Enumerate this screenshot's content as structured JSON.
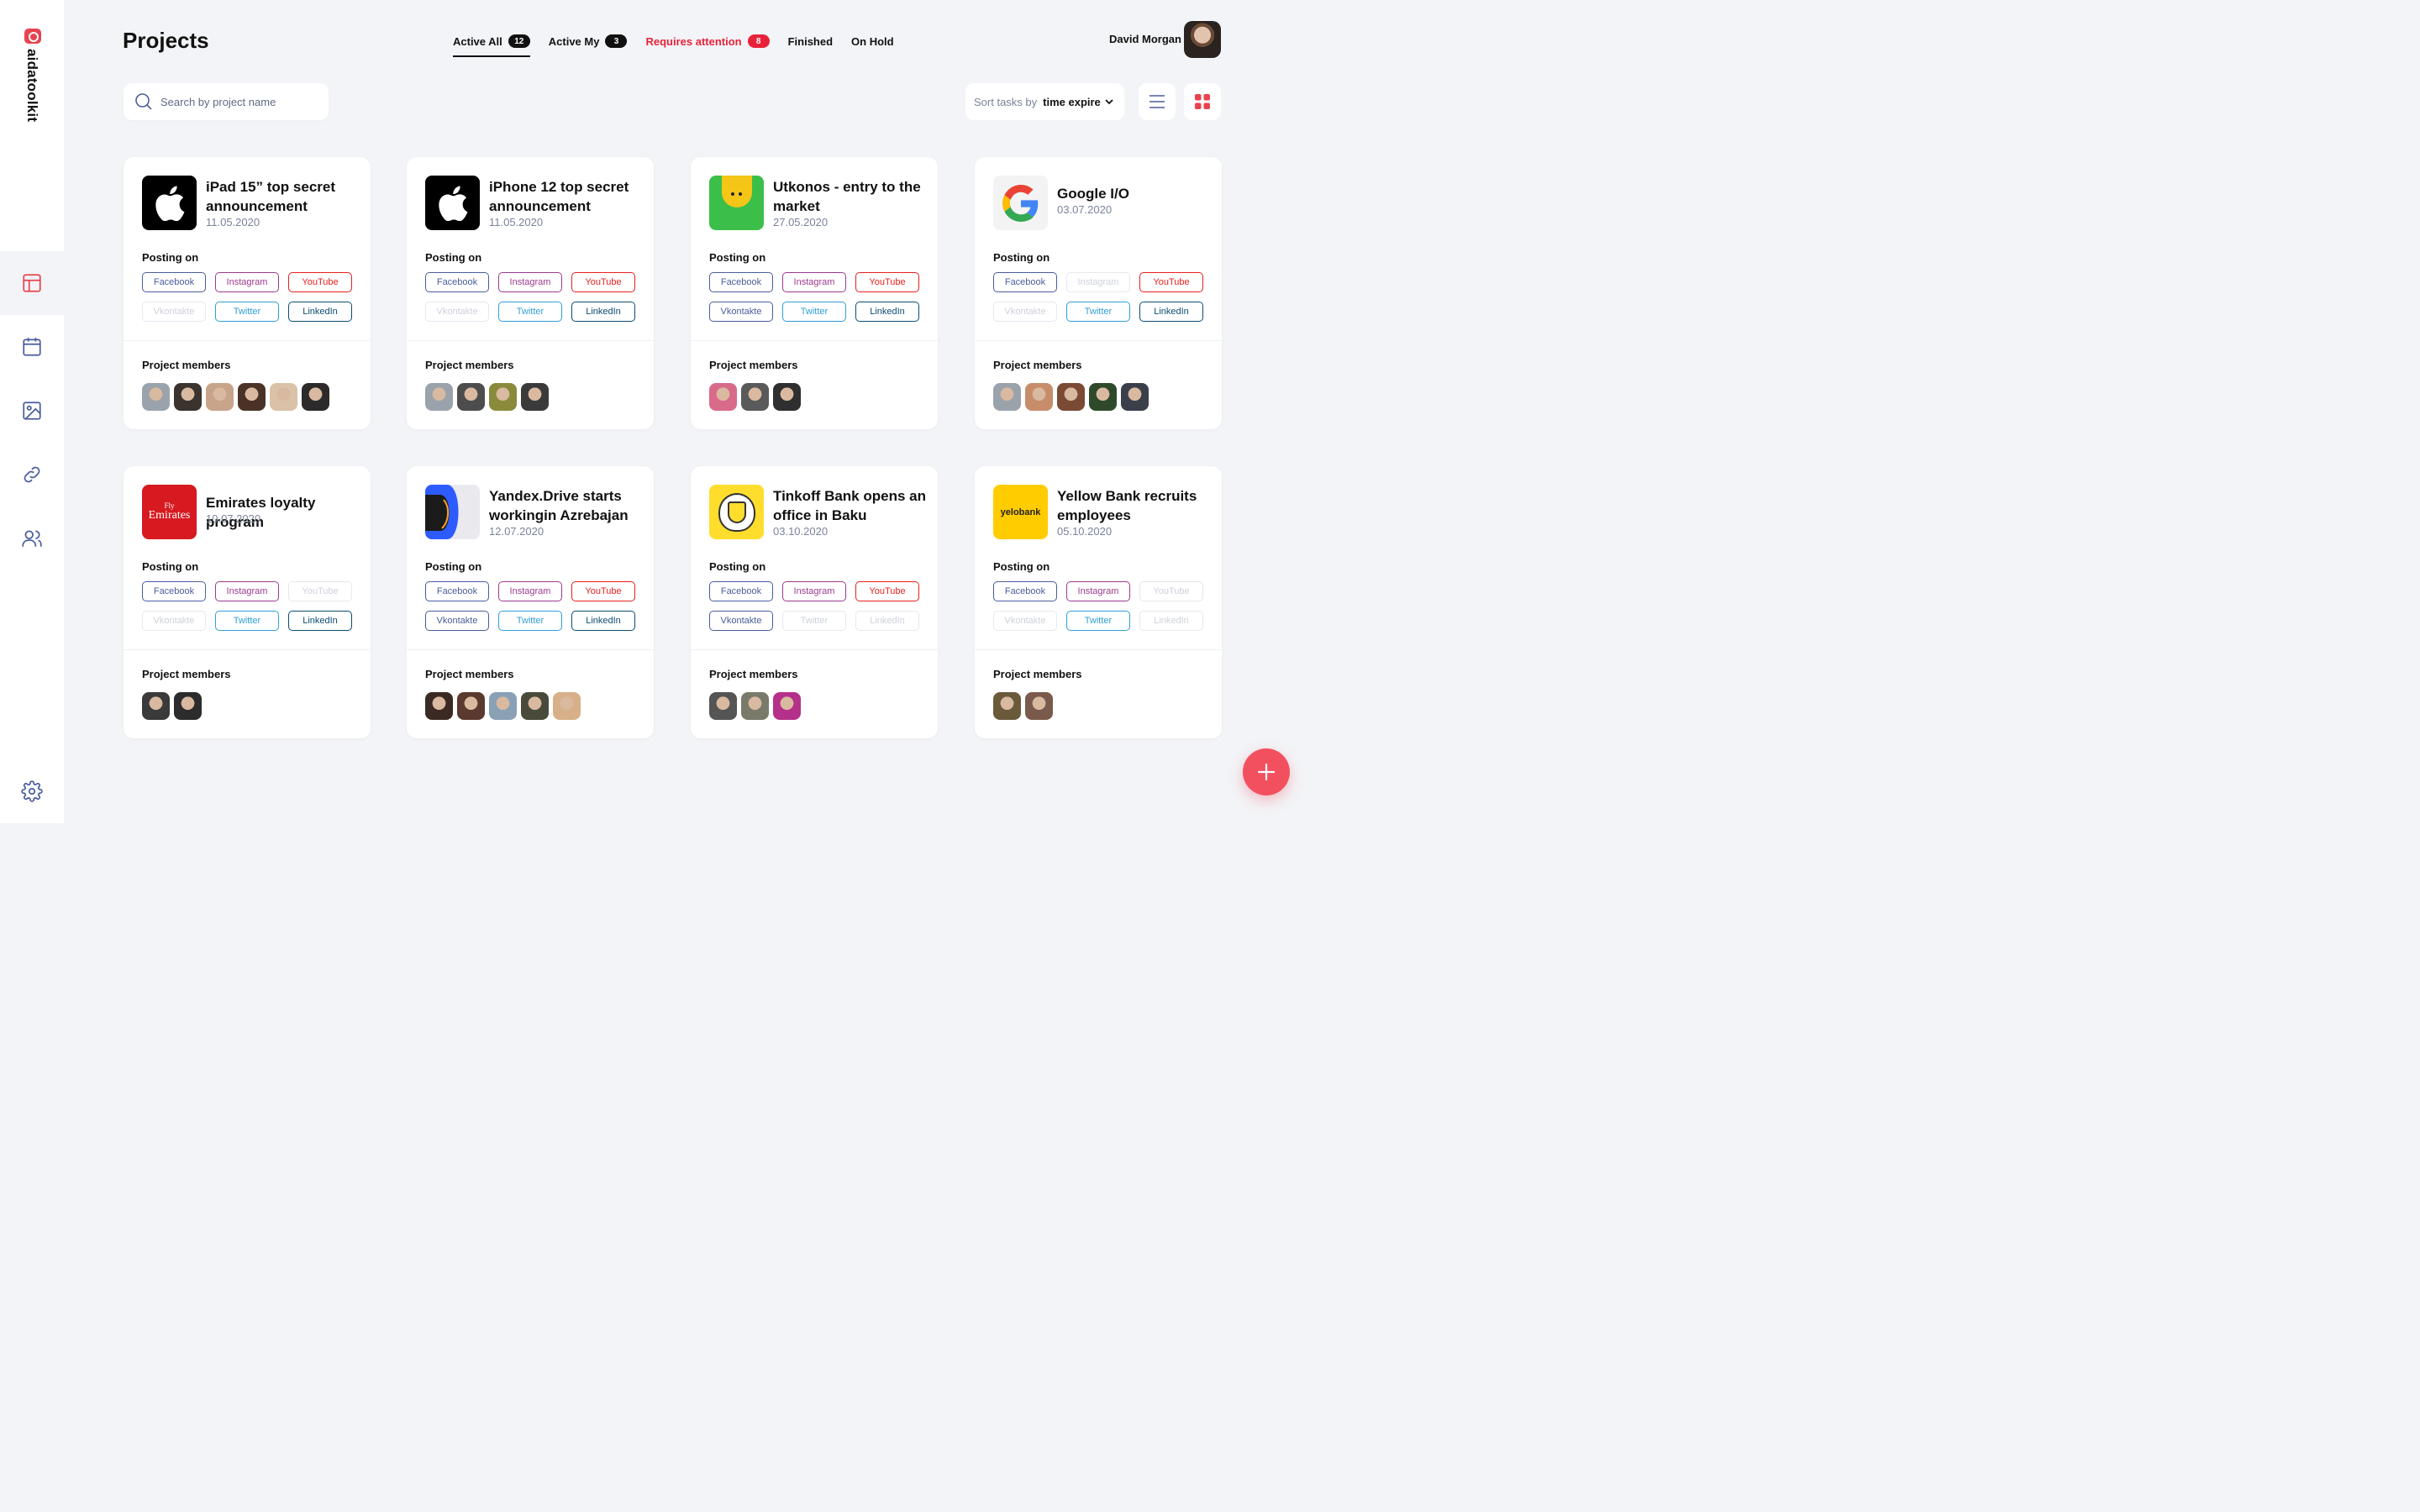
{
  "brand": {
    "name": "aidatoolkit"
  },
  "page_title": "Projects",
  "tabs": [
    {
      "label": "Active All",
      "count": "12",
      "active": true
    },
    {
      "label": "Active My",
      "count": "3"
    },
    {
      "label": "Requires attention",
      "count": "8",
      "attention": true
    },
    {
      "label": "Finished"
    },
    {
      "label": "On Hold"
    }
  ],
  "user": {
    "name": "David Morgan"
  },
  "search": {
    "placeholder": "Search by project name",
    "value": ""
  },
  "sort": {
    "label": "Sort tasks by",
    "value": "time expire"
  },
  "labels": {
    "posting_on": "Posting on",
    "project_members": "Project members"
  },
  "networks": {
    "Facebook": "#4a5d9c",
    "Instagram": "#9b3a8f",
    "YouTube": "#e81e1e",
    "Vkontakte": "#4a5d9c",
    "Twitter": "#2f9fd8",
    "LinkedIn": "#0b4c73"
  },
  "cards": [
    {
      "title_lines": [
        "iPad 15” top secret",
        "announcement"
      ],
      "date": "11.05.2020",
      "logo": "apple",
      "socials": {
        "Facebook": true,
        "Instagram": true,
        "YouTube": true,
        "Vkontakte": false,
        "Twitter": true,
        "LinkedIn": true
      },
      "members": [
        "#9aa3ab",
        "#3b342e",
        "#c7a48a",
        "#4a3326",
        "#d9c2a8",
        "#2c2a2a"
      ]
    },
    {
      "title_lines": [
        "iPhone 12 top secret",
        "announcement"
      ],
      "date": "11.05.2020",
      "logo": "apple",
      "socials": {
        "Facebook": true,
        "Instagram": true,
        "YouTube": true,
        "Vkontakte": false,
        "Twitter": true,
        "LinkedIn": true
      },
      "members": [
        "#9aa3ab",
        "#4d4d4d",
        "#8a8b3a",
        "#3a3a3a"
      ]
    },
    {
      "title_lines": [
        "Utkonos - entry to the",
        "market"
      ],
      "date": "27.05.2020",
      "logo": "utkonos",
      "socials": {
        "Facebook": true,
        "Instagram": true,
        "YouTube": true,
        "Vkontakte": true,
        "Twitter": true,
        "LinkedIn": true
      },
      "members": [
        "#d96a8a",
        "#5a5a5a",
        "#2f2f2f"
      ]
    },
    {
      "title_lines": [
        "Google I/O"
      ],
      "date": "03.07.2020",
      "logo": "google",
      "socials": {
        "Facebook": true,
        "Instagram": false,
        "YouTube": true,
        "Vkontakte": false,
        "Twitter": true,
        "LinkedIn": true
      },
      "members": [
        "#9aa3ab",
        "#c78d6a",
        "#7a4a35",
        "#2e4a2a",
        "#3a3f4a"
      ]
    },
    {
      "title_lines": [
        "Emirates loyalty program"
      ],
      "date": "10.07.2020",
      "logo": "emirates",
      "logo_text": [
        "Fly",
        "Emirates"
      ],
      "socials": {
        "Facebook": true,
        "Instagram": true,
        "YouTube": false,
        "Vkontakte": false,
        "Twitter": true,
        "LinkedIn": true
      },
      "members": [
        "#3a3a3a",
        "#2c2c2c"
      ]
    },
    {
      "title_lines": [
        "Yandex.Drive starts",
        "workingin Azrebajan"
      ],
      "date": "12.07.2020",
      "logo": "yandex",
      "socials": {
        "Facebook": true,
        "Instagram": true,
        "YouTube": true,
        "Vkontakte": true,
        "Twitter": true,
        "LinkedIn": true
      },
      "members": [
        "#3b2a24",
        "#5a3a2f",
        "#8aa0b5",
        "#4a4a3a",
        "#d7b089"
      ]
    },
    {
      "title_lines": [
        "Tinkoff Bank opens an",
        "office in Baku"
      ],
      "date": "03.10.2020",
      "logo": "tinkoff",
      "socials": {
        "Facebook": true,
        "Instagram": true,
        "YouTube": true,
        "Vkontakte": true,
        "Twitter": false,
        "LinkedIn": false
      },
      "members": [
        "#555555",
        "#7a7a6a",
        "#b5308a"
      ]
    },
    {
      "title_lines": [
        "Yellow Bank recruits",
        "employees"
      ],
      "date": "05.10.2020",
      "logo": "yelobank",
      "logo_text": [
        "yelobank"
      ],
      "socials": {
        "Facebook": true,
        "Instagram": true,
        "YouTube": false,
        "Vkontakte": false,
        "Twitter": true,
        "LinkedIn": false
      },
      "members": [
        "#6a5a3a",
        "#7a5a4a"
      ]
    }
  ]
}
